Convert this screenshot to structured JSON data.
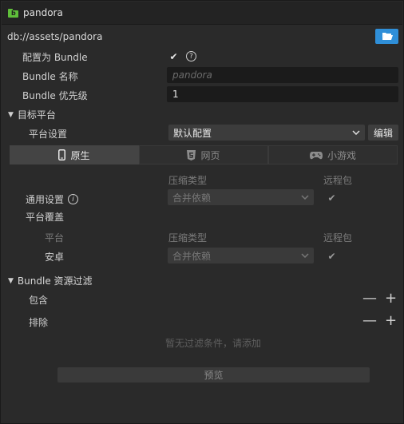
{
  "window": {
    "title": "pandora"
  },
  "path": {
    "text": "db://assets/pandora"
  },
  "bundle": {
    "is_bundle_label": "配置为 Bundle",
    "is_bundle_checked": true,
    "help_glyph": "?",
    "name_label": "Bundle 名称",
    "name_placeholder": "pandora",
    "priority_label": "Bundle 优先级",
    "priority_value": "1"
  },
  "target_platform": {
    "section_label": "目标平台",
    "platform_settings_label": "平台设置",
    "platform_settings_value": "默认配置",
    "edit_button": "编辑",
    "tabs": [
      {
        "label": "原生",
        "icon": "mobile-icon",
        "active": true
      },
      {
        "label": "网页",
        "icon": "html5-icon",
        "active": false
      },
      {
        "label": "小游戏",
        "icon": "gamepad-icon",
        "active": false
      }
    ],
    "col_compression": "压缩类型",
    "col_remote": "远程包",
    "general_label": "通用设置",
    "general_info_glyph": "i",
    "general_compression": "合并依赖",
    "general_remote": true,
    "override_label": "平台覆盖",
    "override_col_platform": "平台",
    "override_col_compression": "压缩类型",
    "override_col_remote": "远程包",
    "override_row": {
      "platform": "安卓",
      "compression": "合并依赖",
      "remote": true
    }
  },
  "filter": {
    "section_label": "Bundle 资源过滤",
    "include_label": "包含",
    "exclude_label": "排除",
    "empty_hint": "暂无过滤条件，请添加",
    "minus": "—",
    "plus": "+"
  },
  "preview_button": "预览",
  "colors": {
    "accent": "#2f8fd8",
    "folder": "#5fbf3a",
    "background": "#2a2a2a"
  }
}
